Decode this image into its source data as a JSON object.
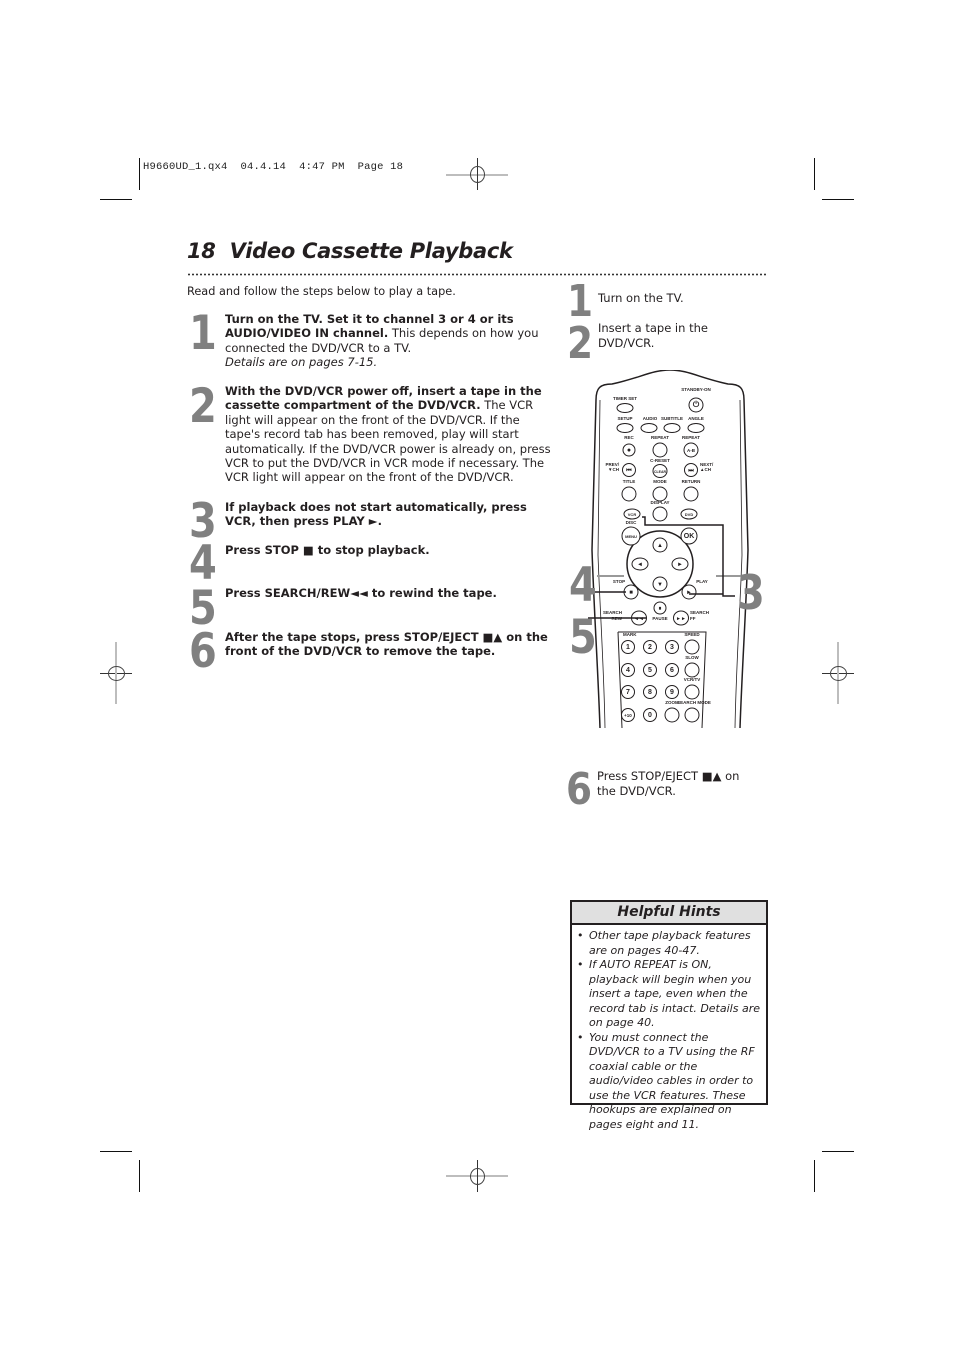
{
  "slug": {
    "file": "H9660UD_1.qx4",
    "date": "04.4.14",
    "time": "4:47 PM",
    "page_label": "Page 18"
  },
  "header": {
    "page_number": "18",
    "title": "Video Cassette Playback"
  },
  "intro": "Read and follow the steps below to play a tape.",
  "steps": [
    {
      "number": "1",
      "bold": "Turn on the TV. Set it to channel 3 or 4 or its AUDIO/VIDEO IN channel.",
      "text": " This depends on how you connected the DVD/VCR to a TV.",
      "italic": "Details are on pages 7-15."
    },
    {
      "number": "2",
      "bold": "With the DVD/VCR power off, insert a tape in the cassette compartment of the DVD/VCR.",
      "text": " The VCR light will appear on the front of the DVD/VCR. If the tape's record tab has been removed, play will start automatically. If the DVD/VCR power is already on, press VCR to put the DVD/VCR in VCR mode if necessary. The VCR light will appear on the front of the DVD/VCR.",
      "italic": ""
    },
    {
      "number": "3",
      "bold": "If playback does not start automatically, press VCR, then press PLAY ►.",
      "text": "",
      "italic": ""
    },
    {
      "number": "4",
      "bold": "Press STOP ■ to stop playback.",
      "text": "",
      "italic": ""
    },
    {
      "number": "5",
      "bold": "Press SEARCH/REW◄◄ to rewind the tape.",
      "text": "",
      "italic": ""
    },
    {
      "number": "6",
      "bold": "After the tape stops, press STOP/EJECT ■▲ on the front of the DVD/VCR to remove the tape.",
      "text": "",
      "italic": ""
    }
  ],
  "quick_steps": [
    {
      "number": "1",
      "text": "Turn on the TV."
    },
    {
      "number": "2",
      "text": "Insert a tape in the DVD/VCR."
    },
    {
      "number": "6",
      "text": "Press STOP/EJECT ■▲ on the DVD/VCR."
    }
  ],
  "callouts": {
    "stop": "4",
    "rew": "5",
    "play": "3"
  },
  "remote": {
    "labels": {
      "standby": "STANDBY-ON",
      "timer_set": "TIMER SET",
      "setup": "SETUP",
      "audio": "AUDIO",
      "subtitle": "SUBTITLE",
      "angle": "ANGLE",
      "rec": "REC",
      "repeat": "REPEAT",
      "repeat_ab": "REPEAT",
      "ab": "A-B",
      "prev": "PREV/",
      "ch_down": "▼CH",
      "c_reset": "C-RESET",
      "clear": "CLEAR",
      "next": "NEXT/",
      "ch_up": "▲CH",
      "title": "TITLE",
      "mode": "MODE",
      "return": "RETURN",
      "display": "DISPLAY",
      "vcr": "VCR",
      "dvd": "DVD",
      "disc": "DISC",
      "menu": "MENU",
      "ok": "OK",
      "stop": "STOP",
      "play": "PLAY",
      "search_rew": "SEARCH",
      "rew": "REW",
      "pause": "PAUSE",
      "search_ff": "SEARCH",
      "ff": "FF",
      "mark": "MARK",
      "speed": "SPEED",
      "slow": "SLOW",
      "vcrtv": "VCR/TV",
      "zoom": "ZOOM",
      "search_mode": "SEARCH MODE"
    },
    "digits": [
      "1",
      "2",
      "3",
      "4",
      "5",
      "6",
      "7",
      "8",
      "9",
      "+10",
      "0"
    ]
  },
  "hints": {
    "title": "Helpful Hints",
    "items": [
      "Other tape playback features are on pages 40-47.",
      "If AUTO REPEAT is ON, playback will begin when you insert a tape, even when the record tab is intact. Details are on page 40.",
      "You must connect the DVD/VCR to a TV using the RF coaxial cable or the audio/video cables in order to use the VCR features. These hookups are explained on pages eight and 11."
    ]
  }
}
